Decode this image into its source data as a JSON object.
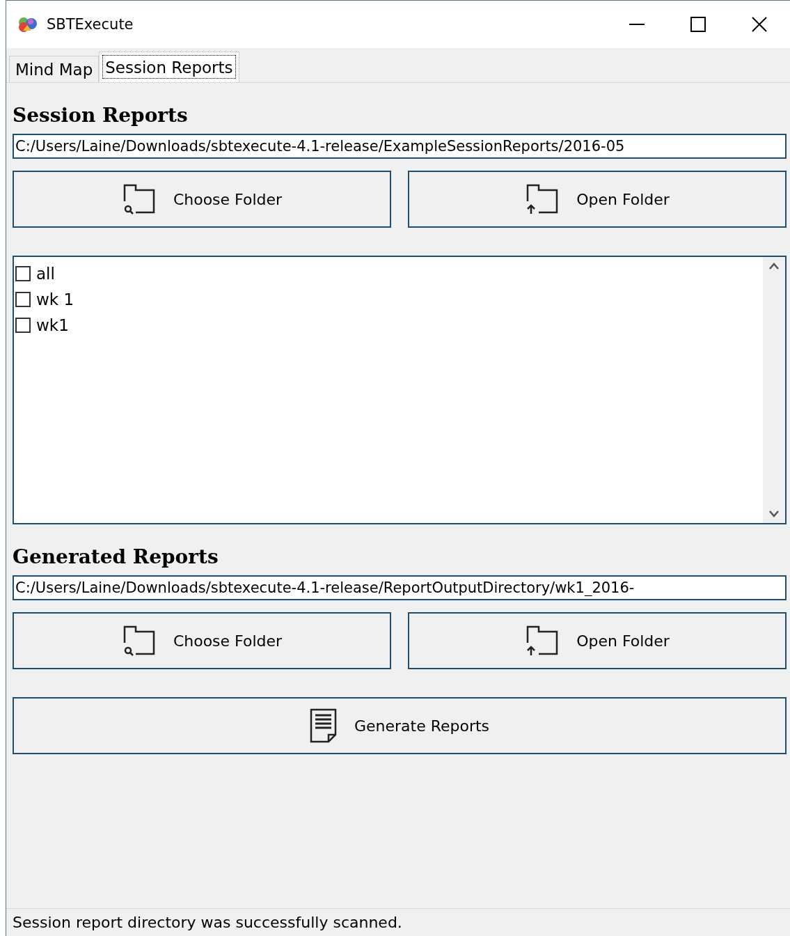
{
  "window": {
    "title": "SBTExecute"
  },
  "tabs": [
    {
      "label": "Mind Map",
      "selected": false
    },
    {
      "label": "Session Reports",
      "selected": true
    }
  ],
  "session_reports": {
    "heading": "Session Reports",
    "path": "C:/Users/Laine/Downloads/sbtexecute-4.1-release/ExampleSessionReports/2016-05",
    "buttons": [
      {
        "kind": "choose",
        "label": "Choose Folder"
      },
      {
        "kind": "open",
        "label": "Open Folder"
      }
    ],
    "folders": [
      {
        "label": "all",
        "checked": false
      },
      {
        "label": "wk 1",
        "checked": false
      },
      {
        "label": "wk1",
        "checked": false
      }
    ]
  },
  "generated_reports": {
    "heading": "Generated Reports",
    "path": "C:/Users/Laine/Downloads/sbtexecute-4.1-release/ReportOutputDirectory/wk1_2016-",
    "buttons": [
      {
        "kind": "choose",
        "label": "Choose Folder"
      },
      {
        "kind": "open",
        "label": "Open Folder"
      }
    ]
  },
  "generate_button": {
    "label": "Generate Reports"
  },
  "status_bar": "Session report directory was successfully scanned."
}
